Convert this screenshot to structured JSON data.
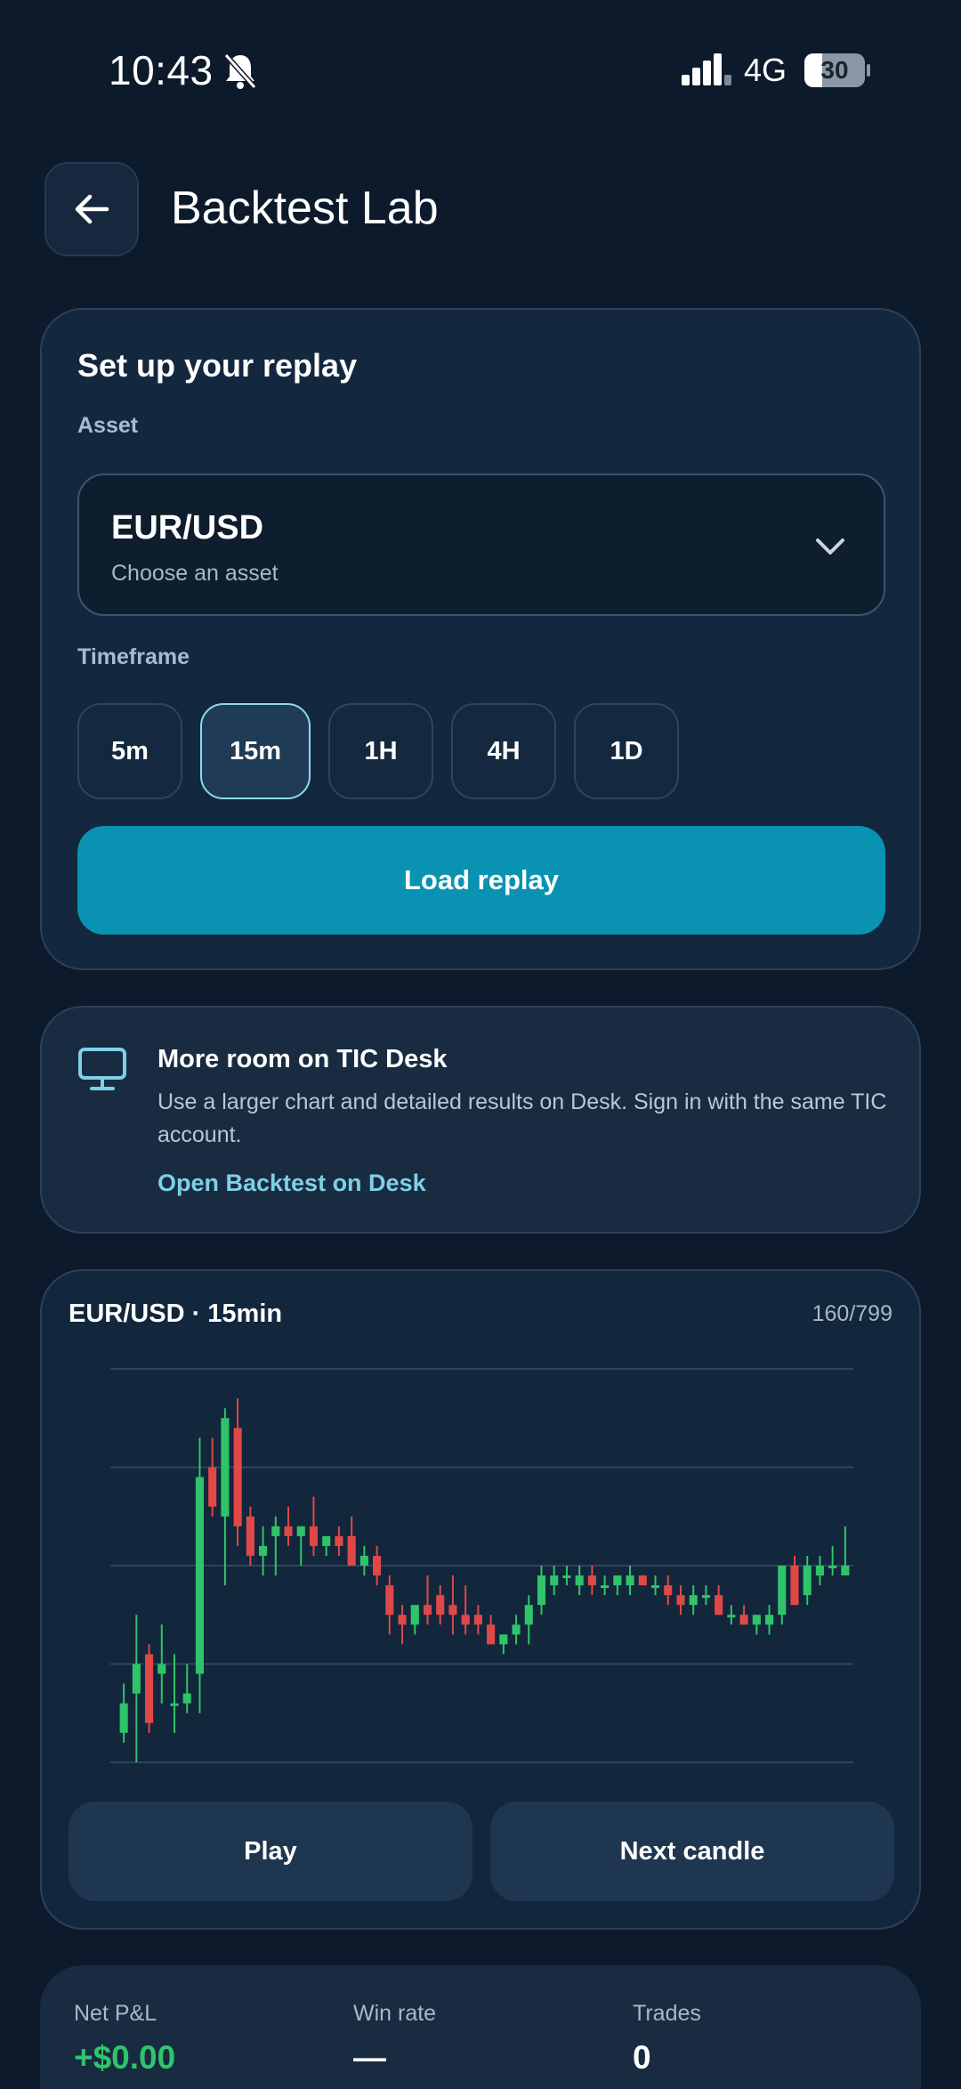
{
  "status_bar": {
    "time": "10:43",
    "network": "4G",
    "battery": "30",
    "battery_level": 0.3
  },
  "header": {
    "title": "Backtest Lab",
    "icons": {
      "back": "arrow-left-icon"
    }
  },
  "setup": {
    "title": "Set up your replay",
    "asset_label": "Asset",
    "asset_value": "EUR/USD",
    "asset_placeholder": "Choose an asset",
    "timeframe_label": "Timeframe",
    "timeframes": [
      "5m",
      "15m",
      "1H",
      "4H",
      "1D"
    ],
    "selected_timeframe": "15m",
    "load_button": "Load replay"
  },
  "desk_promo": {
    "title": "More room on TIC Desk",
    "body": "Use a larger chart and detailed results on Desk. Sign in with the same TIC account.",
    "link": "Open Backtest on Desk",
    "icon": "monitor-icon"
  },
  "chart": {
    "title": "EUR/USD · 15min",
    "counter": "160/799",
    "play_button": "Play",
    "next_button": "Next candle"
  },
  "stats": {
    "net_pl_label": "Net P&L",
    "net_pl_value": "+$0.00",
    "win_rate_label": "Win rate",
    "win_rate_value": "—",
    "trades_label": "Trades",
    "trades_value": "0"
  },
  "colors": {
    "background": "#0c1a2b",
    "accent": "#0a92b2",
    "bullish": "#2fc46a",
    "bearish": "#e04848"
  },
  "chart_data": {
    "type": "candlestick",
    "title": "EUR/USD · 15min",
    "ylim": [
      0,
      4
    ],
    "grid": true,
    "candles": [
      {
        "o": 0.3,
        "h": 0.8,
        "l": 0.2,
        "c": 0.6
      },
      {
        "o": 0.7,
        "h": 1.5,
        "l": 0.0,
        "c": 1.0
      },
      {
        "o": 1.1,
        "h": 1.2,
        "l": 0.3,
        "c": 0.4
      },
      {
        "o": 0.9,
        "h": 1.4,
        "l": 0.6,
        "c": 1.0
      },
      {
        "o": 0.6,
        "h": 1.1,
        "l": 0.3,
        "c": 0.6
      },
      {
        "o": 0.6,
        "h": 1.0,
        "l": 0.5,
        "c": 0.7
      },
      {
        "o": 0.9,
        "h": 3.3,
        "l": 0.5,
        "c": 2.9
      },
      {
        "o": 3.0,
        "h": 3.3,
        "l": 2.5,
        "c": 2.6
      },
      {
        "o": 2.5,
        "h": 3.6,
        "l": 1.8,
        "c": 3.5
      },
      {
        "o": 3.4,
        "h": 3.7,
        "l": 2.2,
        "c": 2.4
      },
      {
        "o": 2.5,
        "h": 2.6,
        "l": 2.0,
        "c": 2.1
      },
      {
        "o": 2.1,
        "h": 2.4,
        "l": 1.9,
        "c": 2.2
      },
      {
        "o": 2.3,
        "h": 2.5,
        "l": 1.9,
        "c": 2.4
      },
      {
        "o": 2.4,
        "h": 2.6,
        "l": 2.2,
        "c": 2.3
      },
      {
        "o": 2.3,
        "h": 2.4,
        "l": 2.0,
        "c": 2.4
      },
      {
        "o": 2.4,
        "h": 2.7,
        "l": 2.1,
        "c": 2.2
      },
      {
        "o": 2.2,
        "h": 2.3,
        "l": 2.1,
        "c": 2.3
      },
      {
        "o": 2.3,
        "h": 2.4,
        "l": 2.1,
        "c": 2.2
      },
      {
        "o": 2.3,
        "h": 2.5,
        "l": 2.0,
        "c": 2.0
      },
      {
        "o": 2.0,
        "h": 2.2,
        "l": 1.9,
        "c": 2.1
      },
      {
        "o": 2.1,
        "h": 2.2,
        "l": 1.8,
        "c": 1.9
      },
      {
        "o": 1.8,
        "h": 1.9,
        "l": 1.3,
        "c": 1.5
      },
      {
        "o": 1.5,
        "h": 1.6,
        "l": 1.2,
        "c": 1.4
      },
      {
        "o": 1.4,
        "h": 1.6,
        "l": 1.3,
        "c": 1.6
      },
      {
        "o": 1.6,
        "h": 1.9,
        "l": 1.4,
        "c": 1.5
      },
      {
        "o": 1.7,
        "h": 1.8,
        "l": 1.4,
        "c": 1.5
      },
      {
        "o": 1.6,
        "h": 1.9,
        "l": 1.3,
        "c": 1.5
      },
      {
        "o": 1.5,
        "h": 1.8,
        "l": 1.3,
        "c": 1.4
      },
      {
        "o": 1.5,
        "h": 1.6,
        "l": 1.3,
        "c": 1.4
      },
      {
        "o": 1.4,
        "h": 1.5,
        "l": 1.2,
        "c": 1.2
      },
      {
        "o": 1.2,
        "h": 1.3,
        "l": 1.1,
        "c": 1.3
      },
      {
        "o": 1.3,
        "h": 1.5,
        "l": 1.2,
        "c": 1.4
      },
      {
        "o": 1.4,
        "h": 1.7,
        "l": 1.2,
        "c": 1.6
      },
      {
        "o": 1.6,
        "h": 2.0,
        "l": 1.5,
        "c": 1.9
      },
      {
        "o": 1.8,
        "h": 2.0,
        "l": 1.7,
        "c": 1.9
      },
      {
        "o": 1.9,
        "h": 2.0,
        "l": 1.8,
        "c": 1.9
      },
      {
        "o": 1.8,
        "h": 2.0,
        "l": 1.7,
        "c": 1.9
      },
      {
        "o": 1.9,
        "h": 2.0,
        "l": 1.7,
        "c": 1.8
      },
      {
        "o": 1.8,
        "h": 1.9,
        "l": 1.7,
        "c": 1.8
      },
      {
        "o": 1.8,
        "h": 1.9,
        "l": 1.7,
        "c": 1.9
      },
      {
        "o": 1.8,
        "h": 2.0,
        "l": 1.7,
        "c": 1.9
      },
      {
        "o": 1.9,
        "h": 1.9,
        "l": 1.8,
        "c": 1.8
      },
      {
        "o": 1.8,
        "h": 1.9,
        "l": 1.7,
        "c": 1.8
      },
      {
        "o": 1.8,
        "h": 1.9,
        "l": 1.6,
        "c": 1.7
      },
      {
        "o": 1.7,
        "h": 1.8,
        "l": 1.5,
        "c": 1.6
      },
      {
        "o": 1.6,
        "h": 1.8,
        "l": 1.5,
        "c": 1.7
      },
      {
        "o": 1.7,
        "h": 1.8,
        "l": 1.6,
        "c": 1.7
      },
      {
        "o": 1.7,
        "h": 1.8,
        "l": 1.5,
        "c": 1.5
      },
      {
        "o": 1.5,
        "h": 1.6,
        "l": 1.4,
        "c": 1.5
      },
      {
        "o": 1.5,
        "h": 1.6,
        "l": 1.4,
        "c": 1.4
      },
      {
        "o": 1.4,
        "h": 1.5,
        "l": 1.3,
        "c": 1.5
      },
      {
        "o": 1.4,
        "h": 1.6,
        "l": 1.3,
        "c": 1.5
      },
      {
        "o": 1.5,
        "h": 2.0,
        "l": 1.4,
        "c": 2.0
      },
      {
        "o": 2.0,
        "h": 2.1,
        "l": 1.6,
        "c": 1.6
      },
      {
        "o": 1.7,
        "h": 2.1,
        "l": 1.6,
        "c": 2.0
      },
      {
        "o": 1.9,
        "h": 2.1,
        "l": 1.8,
        "c": 2.0
      },
      {
        "o": 2.0,
        "h": 2.2,
        "l": 1.9,
        "c": 2.0
      },
      {
        "o": 1.9,
        "h": 2.4,
        "l": 1.9,
        "c": 2.0
      }
    ]
  }
}
